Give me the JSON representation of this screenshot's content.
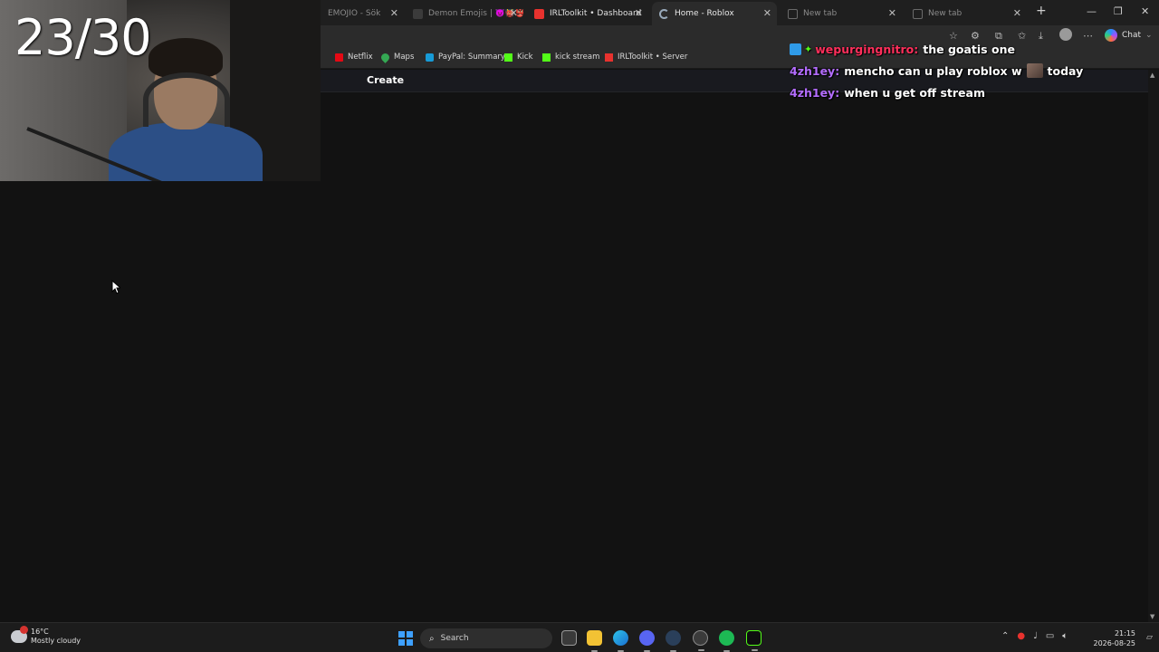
{
  "overlay": {
    "counter": "23/30",
    "chat": [
      {
        "user": "wepurgingnitro:",
        "user_color": "#ff2f5b",
        "message": "the goatis one",
        "badges": [
          "boost-badge",
          "star-badge"
        ]
      },
      {
        "user": "4zh1ey:",
        "user_color": "#b46dff",
        "message_before": "mencho can u play roblox w",
        "emote": "emote-image",
        "message_after": "today"
      },
      {
        "user": "4zh1ey:",
        "user_color": "#b46dff",
        "message": "when u get off stream"
      }
    ]
  },
  "browser": {
    "tabs": [
      {
        "title": "EMOJIO - Sök",
        "icon": "emojio-favicon",
        "active": false
      },
      {
        "title": "Demon Emojis | 👿👹👺",
        "icon": "page-favicon",
        "active": false
      },
      {
        "title": "IRLToolkit • Dashboard",
        "icon": "irltoolkit-favicon",
        "active": false
      },
      {
        "title": "Home - Roblox",
        "icon": "loading-spinner-icon",
        "active": true
      },
      {
        "title": "New tab",
        "icon": "newtab-favicon",
        "active": false
      },
      {
        "title": "New tab",
        "icon": "newtab-favicon",
        "active": false
      }
    ],
    "toolbar": {
      "chat_label": "Chat"
    },
    "bookmarks": [
      {
        "label": "Netflix",
        "icon": "netflix-icon",
        "color": "#e50914"
      },
      {
        "label": "Maps",
        "icon": "maps-pin-icon",
        "color": "#34a853"
      },
      {
        "label": "PayPal: Summary",
        "icon": "paypal-icon",
        "color": "#179bd7"
      },
      {
        "label": "Kick",
        "icon": "kick-icon",
        "color": "#53fc18"
      },
      {
        "label": "kick stream",
        "icon": "kick-icon",
        "color": "#53fc18"
      },
      {
        "label": "IRLToolkit • Server",
        "icon": "irltoolkit-icon",
        "color": "#e8322e"
      }
    ]
  },
  "page": {
    "nav_create": "Create"
  },
  "taskbar": {
    "weather_temp": "16°C",
    "weather_desc": "Mostly cloudy",
    "search_placeholder": "Search",
    "time": "21:15",
    "date": "2026-08-25"
  },
  "colors": {
    "page_bg": "#121212",
    "chrome_bg": "#2b2b2b",
    "tabstrip_bg": "#1f1f1f",
    "accent_windows": "#3ea0ff"
  }
}
